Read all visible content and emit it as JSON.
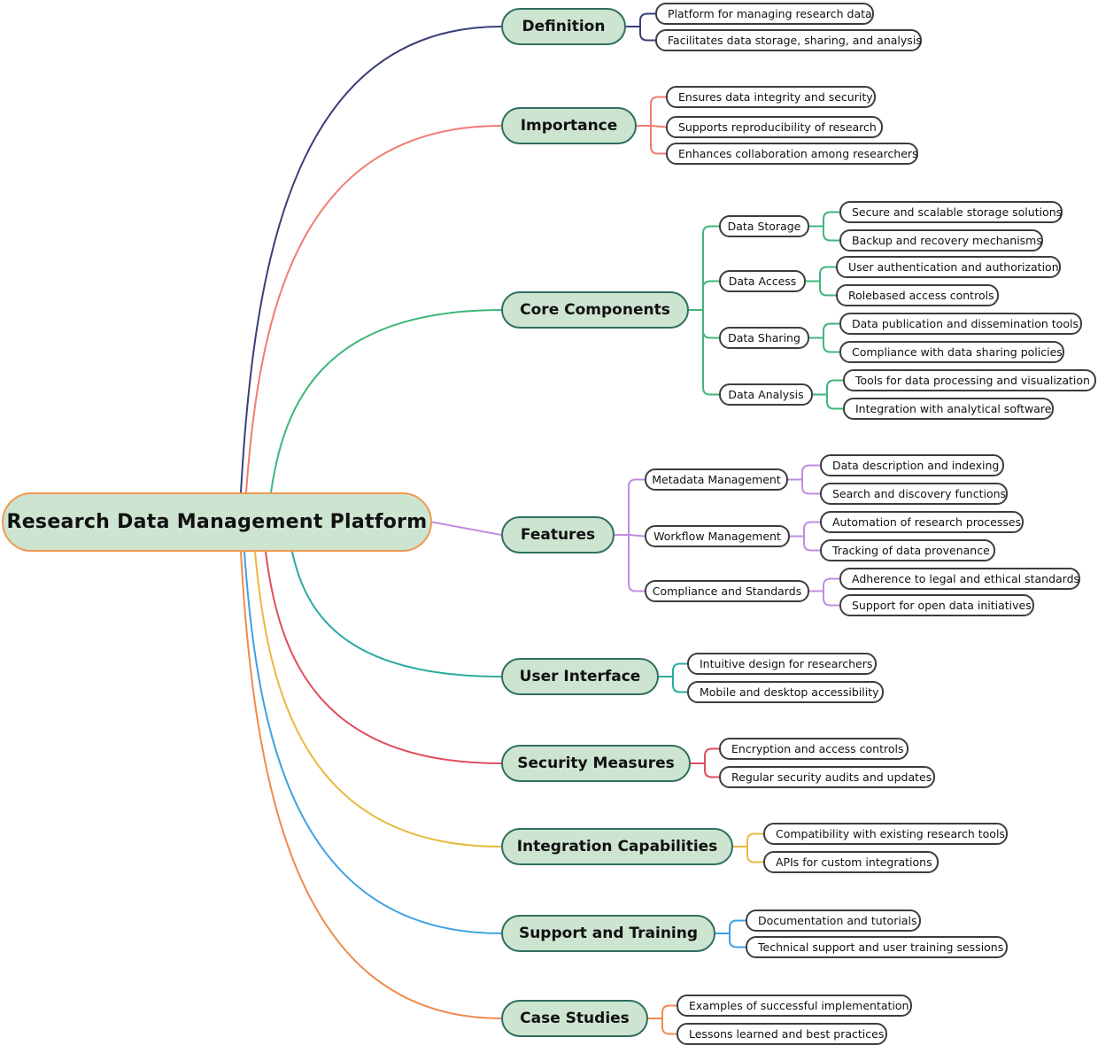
{
  "root": {
    "label": "Research Data Management Platform",
    "border_color": "#ef9a4f",
    "fill": "#cde4d1"
  },
  "branches": [
    {
      "label": "Definition",
      "color": "#3a3f7a",
      "children": [
        {
          "label": "Platform for managing research data"
        },
        {
          "label": "Facilitates data storage, sharing, and analysis"
        }
      ]
    },
    {
      "label": "Importance",
      "color": "#f27b72",
      "children": [
        {
          "label": "Ensures data integrity and security"
        },
        {
          "label": "Supports reproducibility of research"
        },
        {
          "label": "Enhances collaboration among researchers"
        }
      ]
    },
    {
      "label": "Core Components",
      "color": "#3fb77a",
      "children": [
        {
          "label": "Data Storage",
          "children": [
            {
              "label": "Secure and scalable storage solutions"
            },
            {
              "label": "Backup and recovery mechanisms"
            }
          ]
        },
        {
          "label": "Data Access",
          "children": [
            {
              "label": "User authentication and authorization"
            },
            {
              "label": "Rolebased access controls"
            }
          ]
        },
        {
          "label": "Data Sharing",
          "children": [
            {
              "label": "Data publication and dissemination tools"
            },
            {
              "label": "Compliance with data sharing policies"
            }
          ]
        },
        {
          "label": "Data Analysis",
          "children": [
            {
              "label": "Tools for data processing and visualization"
            },
            {
              "label": "Integration with analytical software"
            }
          ]
        }
      ]
    },
    {
      "label": "Features",
      "color": "#c08de0",
      "children": [
        {
          "label": "Metadata Management",
          "children": [
            {
              "label": "Data description and indexing"
            },
            {
              "label": "Search and discovery functions"
            }
          ]
        },
        {
          "label": "Workflow Management",
          "children": [
            {
              "label": "Automation of research processes"
            },
            {
              "label": "Tracking of data provenance"
            }
          ]
        },
        {
          "label": "Compliance and Standards",
          "children": [
            {
              "label": "Adherence to legal and ethical standards"
            },
            {
              "label": "Support for open data initiatives"
            }
          ]
        }
      ]
    },
    {
      "label": "User Interface",
      "color": "#2aaba0",
      "children": [
        {
          "label": "Intuitive design for researchers"
        },
        {
          "label": "Mobile and desktop accessibility"
        }
      ]
    },
    {
      "label": "Security Measures",
      "color": "#e04e5e",
      "children": [
        {
          "label": "Encryption and access controls"
        },
        {
          "label": "Regular security audits and updates"
        }
      ]
    },
    {
      "label": "Integration Capabilities",
      "color": "#eab83e",
      "children": [
        {
          "label": "Compatibility with existing research tools"
        },
        {
          "label": "APIs for custom integrations"
        }
      ]
    },
    {
      "label": "Support and Training",
      "color": "#3fa0e0",
      "children": [
        {
          "label": "Documentation and tutorials"
        },
        {
          "label": "Technical support and user training sessions"
        }
      ]
    },
    {
      "label": "Case Studies",
      "color": "#ef8a4f",
      "children": [
        {
          "label": "Examples of successful implementation"
        },
        {
          "label": "Lessons learned and best practices"
        }
      ]
    }
  ]
}
